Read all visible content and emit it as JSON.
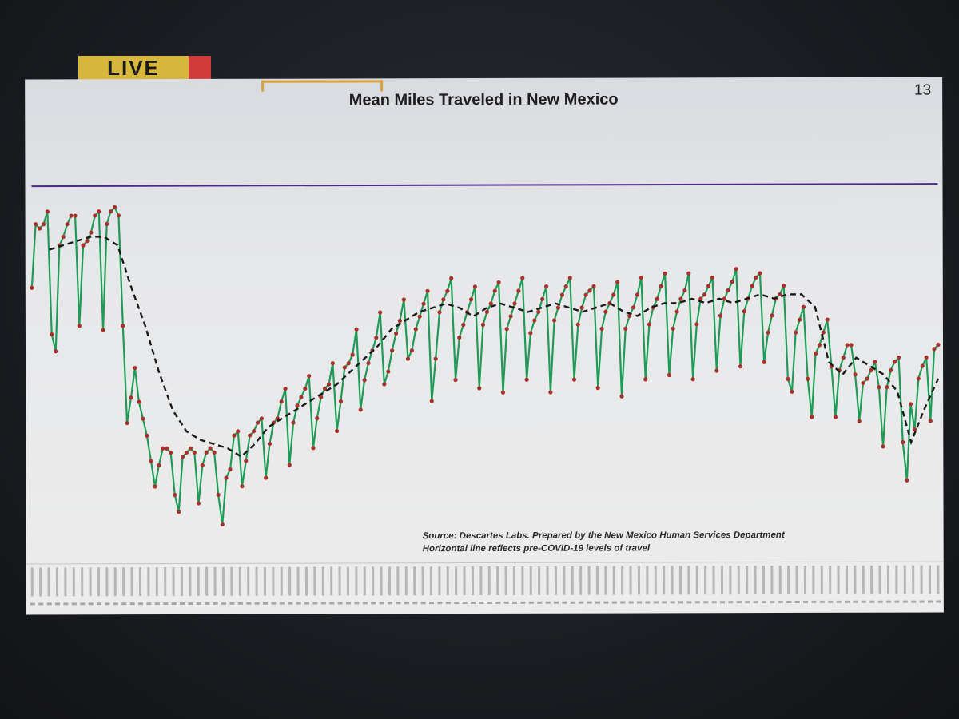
{
  "overlay": {
    "live_label": "LIVE"
  },
  "slide": {
    "number": "13",
    "source_line1": "Source: Descartes Labs.  Prepared by the New Mexico Human Services Department",
    "source_line2": "Horizontal line reflects pre-COVID-19 levels of travel"
  },
  "chart_data": {
    "type": "line",
    "title": "Mean Miles Traveled in New Mexico",
    "xlabel": "",
    "ylabel": "",
    "baseline_value": 0.88,
    "ylim": [
      0.0,
      1.0
    ],
    "x_tick_labels_legible": false,
    "grid": false,
    "legend": "none",
    "series": [
      {
        "style": "daily",
        "color": "#1f9a57",
        "marker_color": "#a8322a",
        "values": [
          0.64,
          0.79,
          0.78,
          0.79,
          0.82,
          0.53,
          0.49,
          0.74,
          0.76,
          0.79,
          0.81,
          0.81,
          0.55,
          0.74,
          0.75,
          0.77,
          0.81,
          0.82,
          0.54,
          0.79,
          0.82,
          0.83,
          0.81,
          0.55,
          0.32,
          0.38,
          0.45,
          0.37,
          0.33,
          0.29,
          0.23,
          0.17,
          0.22,
          0.26,
          0.26,
          0.25,
          0.15,
          0.11,
          0.24,
          0.25,
          0.26,
          0.25,
          0.13,
          0.22,
          0.25,
          0.26,
          0.25,
          0.15,
          0.08,
          0.19,
          0.21,
          0.29,
          0.3,
          0.17,
          0.23,
          0.29,
          0.3,
          0.32,
          0.33,
          0.19,
          0.27,
          0.32,
          0.33,
          0.37,
          0.4,
          0.22,
          0.32,
          0.36,
          0.38,
          0.4,
          0.43,
          0.26,
          0.33,
          0.38,
          0.4,
          0.41,
          0.46,
          0.3,
          0.37,
          0.45,
          0.46,
          0.48,
          0.54,
          0.35,
          0.42,
          0.46,
          0.49,
          0.52,
          0.58,
          0.41,
          0.44,
          0.49,
          0.53,
          0.56,
          0.61,
          0.47,
          0.49,
          0.54,
          0.57,
          0.6,
          0.63,
          0.37,
          0.47,
          0.58,
          0.61,
          0.63,
          0.66,
          0.42,
          0.52,
          0.55,
          0.58,
          0.61,
          0.64,
          0.4,
          0.55,
          0.58,
          0.6,
          0.63,
          0.65,
          0.39,
          0.54,
          0.57,
          0.6,
          0.63,
          0.66,
          0.42,
          0.53,
          0.56,
          0.58,
          0.61,
          0.64,
          0.39,
          0.56,
          0.59,
          0.62,
          0.64,
          0.66,
          0.42,
          0.55,
          0.59,
          0.62,
          0.63,
          0.64,
          0.4,
          0.54,
          0.58,
          0.6,
          0.62,
          0.65,
          0.38,
          0.54,
          0.57,
          0.59,
          0.62,
          0.66,
          0.42,
          0.55,
          0.59,
          0.61,
          0.64,
          0.67,
          0.43,
          0.54,
          0.58,
          0.61,
          0.63,
          0.67,
          0.42,
          0.55,
          0.61,
          0.62,
          0.64,
          0.66,
          0.44,
          0.57,
          0.61,
          0.63,
          0.65,
          0.68,
          0.45,
          0.58,
          0.61,
          0.64,
          0.66,
          0.67,
          0.46,
          0.53,
          0.57,
          0.61,
          0.62,
          0.64,
          0.42,
          0.39,
          0.53,
          0.56,
          0.59,
          0.42,
          0.33,
          0.48,
          0.5,
          0.53,
          0.56,
          0.45,
          0.33,
          0.44,
          0.47,
          0.5,
          0.5,
          0.43,
          0.32,
          0.41,
          0.42,
          0.44,
          0.46,
          0.4,
          0.26,
          0.4,
          0.44,
          0.46,
          0.47,
          0.27,
          0.18,
          0.36,
          0.3,
          0.42,
          0.45,
          0.47,
          0.32,
          0.49,
          0.5
        ]
      },
      {
        "style": "dashed",
        "color": "#1a1a1a",
        "values": [
          0.73,
          0.74,
          0.75,
          0.76,
          0.76,
          0.74,
          0.64,
          0.55,
          0.44,
          0.35,
          0.3,
          0.28,
          0.27,
          0.26,
          0.24,
          0.27,
          0.31,
          0.33,
          0.35,
          0.37,
          0.39,
          0.41,
          0.44,
          0.47,
          0.5,
          0.54,
          0.56,
          0.58,
          0.59,
          0.6,
          0.59,
          0.57,
          0.59,
          0.6,
          0.59,
          0.58,
          0.59,
          0.6,
          0.59,
          0.58,
          0.59,
          0.6,
          0.58,
          0.57,
          0.59,
          0.6,
          0.6,
          0.61,
          0.6,
          0.61,
          0.6,
          0.61,
          0.62,
          0.61,
          0.62,
          0.62,
          0.59,
          0.46,
          0.43,
          0.47,
          0.45,
          0.43,
          0.39,
          0.27,
          0.35,
          0.42
        ]
      }
    ]
  }
}
